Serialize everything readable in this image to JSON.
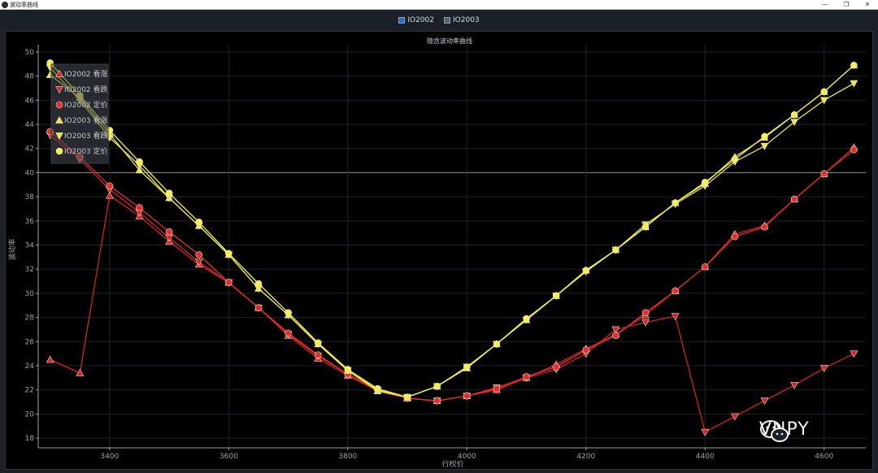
{
  "window": {
    "title": "波动率曲线",
    "controls": {
      "minimize": "—",
      "maximize": "❐",
      "close": "✕"
    }
  },
  "toggles": [
    {
      "label": "IO2002",
      "checked": true
    },
    {
      "label": "IO2003",
      "checked": true
    }
  ],
  "watermark": {
    "text": "VNPY"
  },
  "chart_data": {
    "type": "line",
    "title": "隐含波动率曲线",
    "xlabel": "行权价",
    "ylabel": "波动率",
    "xlim": [
      3280,
      4670
    ],
    "ylim": [
      17.2,
      50.6
    ],
    "xticks": [
      3400,
      3600,
      3800,
      4000,
      4200,
      4400,
      4600
    ],
    "yticks": [
      18,
      20,
      22,
      24,
      26,
      28,
      30,
      32,
      34,
      36,
      38,
      40,
      42,
      44,
      46,
      48,
      50
    ],
    "highlight_y": 40,
    "grid": true,
    "legend_position": "top-left",
    "series": [
      {
        "name": "IO2002 看涨",
        "color": "#d42323",
        "marker": "triangle-up",
        "x": [
          3300,
          3350,
          3400,
          3450,
          3500,
          3550,
          3600,
          3650,
          3700,
          3750,
          3800,
          3850,
          3900,
          3950,
          4000,
          4050,
          4100,
          4150,
          4200,
          4250,
          4300,
          4350,
          4400,
          4450,
          4500,
          4550,
          4600,
          4650
        ],
        "values": [
          24.5,
          23.4,
          38.1,
          36.4,
          34.3,
          32.4,
          30.9,
          28.8,
          26.5,
          24.6,
          23.2,
          21.9,
          21.3,
          21.1,
          21.5,
          22.0,
          23.0,
          24.1,
          25.4,
          26.6,
          28.2,
          30.2,
          32.2,
          34.9,
          35.6,
          37.8,
          39.9,
          42.1
        ]
      },
      {
        "name": "IO2002 看跌",
        "color": "#d42323",
        "marker": "triangle-down",
        "x": [
          3300,
          3350,
          3400,
          3450,
          3500,
          3550,
          3600,
          3650,
          3700,
          3750,
          3800,
          3850,
          3900,
          3950,
          4000,
          4050,
          4100,
          4150,
          4200,
          4250,
          4300,
          4350,
          4400,
          4450,
          4500,
          4550,
          4600,
          4650
        ],
        "values": [
          43.1,
          41.1,
          38.6,
          36.7,
          34.6,
          32.6,
          30.9,
          28.8,
          26.6,
          24.8,
          23.3,
          22.0,
          21.3,
          21.1,
          21.5,
          22.2,
          23.0,
          23.7,
          25.0,
          27.0,
          27.6,
          28.1,
          18.5,
          19.8,
          21.1,
          22.4,
          23.8,
          25.0
        ]
      },
      {
        "name": "IO2002 定价",
        "color": "#e03030",
        "marker": "circle",
        "x": [
          3300,
          3350,
          3400,
          3450,
          3500,
          3550,
          3600,
          3650,
          3700,
          3750,
          3800,
          3850,
          3900,
          3950,
          4000,
          4050,
          4100,
          4150,
          4200,
          4250,
          4300,
          4350,
          4400,
          4450,
          4500,
          4550,
          4600,
          4650
        ],
        "values": [
          43.4,
          41.3,
          38.9,
          37.1,
          35.1,
          33.2,
          30.9,
          28.8,
          26.7,
          24.9,
          23.3,
          22.0,
          21.3,
          21.1,
          21.5,
          22.1,
          23.1,
          23.9,
          25.3,
          26.5,
          28.4,
          30.2,
          32.2,
          34.7,
          35.5,
          37.8,
          39.9,
          41.9
        ]
      },
      {
        "name": "IO2003 看涨",
        "color": "#e8e84a",
        "marker": "triangle-up",
        "x": [
          3300,
          3350,
          3400,
          3450,
          3500,
          3550,
          3600,
          3650,
          3700,
          3750,
          3800,
          3850,
          3900,
          3950,
          4000,
          4050,
          4100,
          4150,
          4200,
          4250,
          4300,
          4350,
          4400,
          4450,
          4500,
          4550,
          4600,
          4650
        ],
        "values": [
          48.1,
          46.2,
          43.2,
          40.2,
          37.9,
          35.6,
          33.2,
          30.4,
          28.2,
          25.8,
          23.6,
          21.9,
          21.4,
          22.3,
          23.8,
          25.8,
          27.8,
          29.8,
          31.9,
          33.6,
          35.5,
          37.5,
          39.1,
          41.3,
          42.9,
          44.8,
          46.7,
          48.9
        ]
      },
      {
        "name": "IO2003 看跌",
        "color": "#e8e84a",
        "marker": "triangle-down",
        "x": [
          3300,
          3350,
          3400,
          3450,
          3500,
          3550,
          3600,
          3650,
          3700,
          3750,
          3800,
          3850,
          3900,
          3950,
          4000,
          4050,
          4100,
          4150,
          4200,
          4250,
          4300,
          4350,
          4400,
          4450,
          4500,
          4550,
          4600,
          4650
        ],
        "values": [
          48.7,
          46.0,
          42.9,
          40.6,
          37.9,
          35.6,
          33.2,
          30.4,
          28.2,
          25.8,
          23.6,
          22.0,
          21.4,
          22.3,
          23.9,
          25.8,
          27.8,
          29.8,
          31.8,
          33.6,
          35.7,
          37.4,
          38.9,
          40.9,
          42.2,
          44.2,
          46.0,
          47.4
        ]
      },
      {
        "name": "IO2003 定价",
        "color": "#f0f050",
        "marker": "circle",
        "x": [
          3300,
          3350,
          3400,
          3450,
          3500,
          3550,
          3600,
          3650,
          3700,
          3750,
          3800,
          3850,
          3900,
          3950,
          4000,
          4050,
          4100,
          4150,
          4200,
          4250,
          4300,
          4350,
          4400,
          4450,
          4500,
          4550,
          4600,
          4650
        ],
        "values": [
          49.1,
          46.4,
          43.5,
          40.9,
          38.3,
          35.9,
          33.3,
          30.8,
          28.4,
          25.9,
          23.7,
          22.1,
          21.4,
          22.3,
          23.9,
          25.8,
          27.9,
          29.8,
          31.9,
          33.6,
          35.5,
          37.5,
          39.2,
          41.1,
          43.0,
          44.8,
          46.7,
          48.9
        ]
      }
    ]
  }
}
